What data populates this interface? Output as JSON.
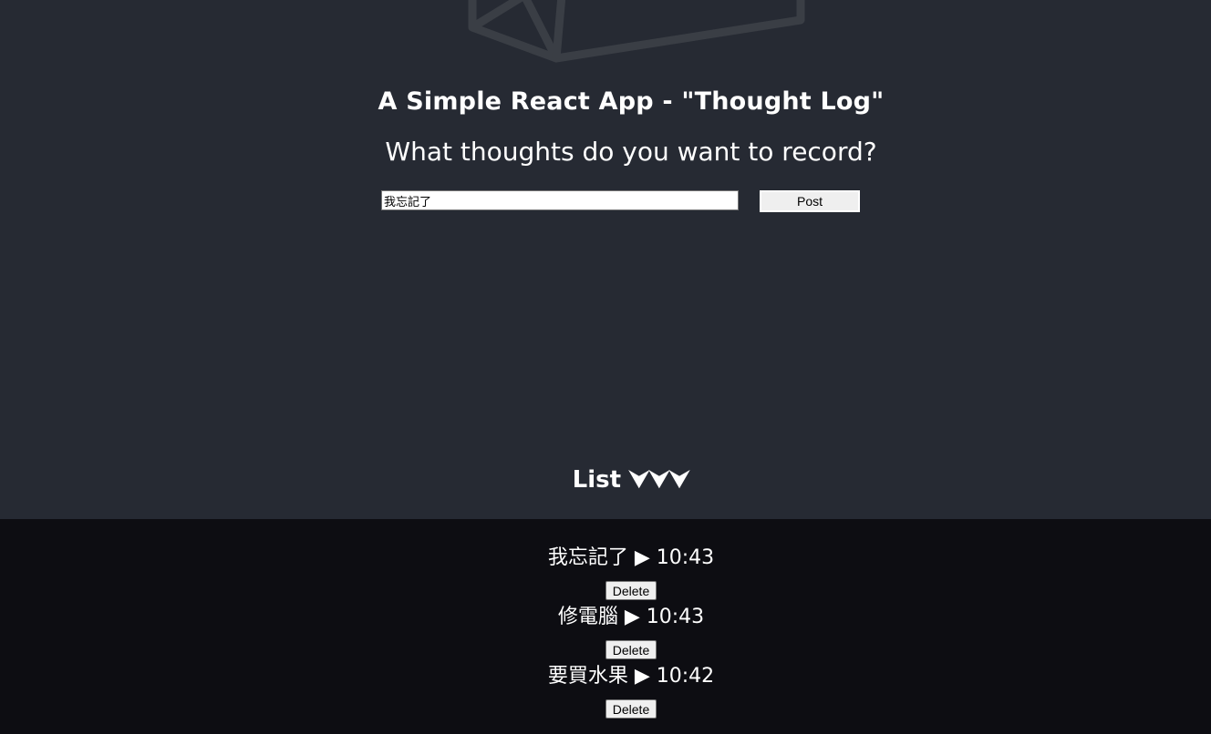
{
  "header": {
    "title": "A Simple React App - \"Thought Log\"",
    "prompt": "What thoughts do you want to record?"
  },
  "form": {
    "input_value": "我忘記了",
    "post_label": "Post"
  },
  "list": {
    "heading": "List ⮟⮟⮟",
    "items": [
      {
        "text": "我忘記了 ▶ 10:43",
        "delete_label": "Delete"
      },
      {
        "text": "修電腦 ▶ 10:43",
        "delete_label": "Delete"
      },
      {
        "text": "要買水果 ▶ 10:42",
        "delete_label": "Delete"
      }
    ]
  },
  "colors": {
    "background_top": "#262a33",
    "background_bottom": "#0d0d12",
    "text": "#ffffff"
  },
  "icons": {
    "logo": "react-logo-outline-icon"
  }
}
